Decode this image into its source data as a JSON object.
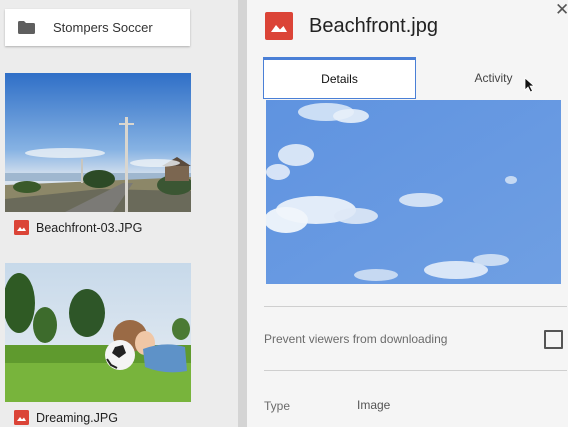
{
  "file_list": {
    "folder": {
      "name": "Stompers Soccer",
      "icon": "folder-icon"
    },
    "files": [
      {
        "name": "Beachfront-03.JPG",
        "icon": "image-file-icon"
      },
      {
        "name": "Dreaming.JPG",
        "icon": "image-file-icon"
      }
    ]
  },
  "details": {
    "title": "Beachfront.jpg",
    "title_icon": "image-file-icon",
    "close_icon": "close-icon",
    "close_glyph": "✕",
    "tabs": [
      {
        "label": "Details",
        "selected": true
      },
      {
        "label": "Activity",
        "selected": false
      }
    ],
    "prevent_download_label": "Prevent viewers from downloading",
    "prevent_download_checked": false,
    "type_key": "Type",
    "type_value": "Image"
  },
  "colors": {
    "image_icon_red": "#db4437",
    "tab_accent": "#4a7fd6",
    "sky_blue": "#5f93e0"
  }
}
